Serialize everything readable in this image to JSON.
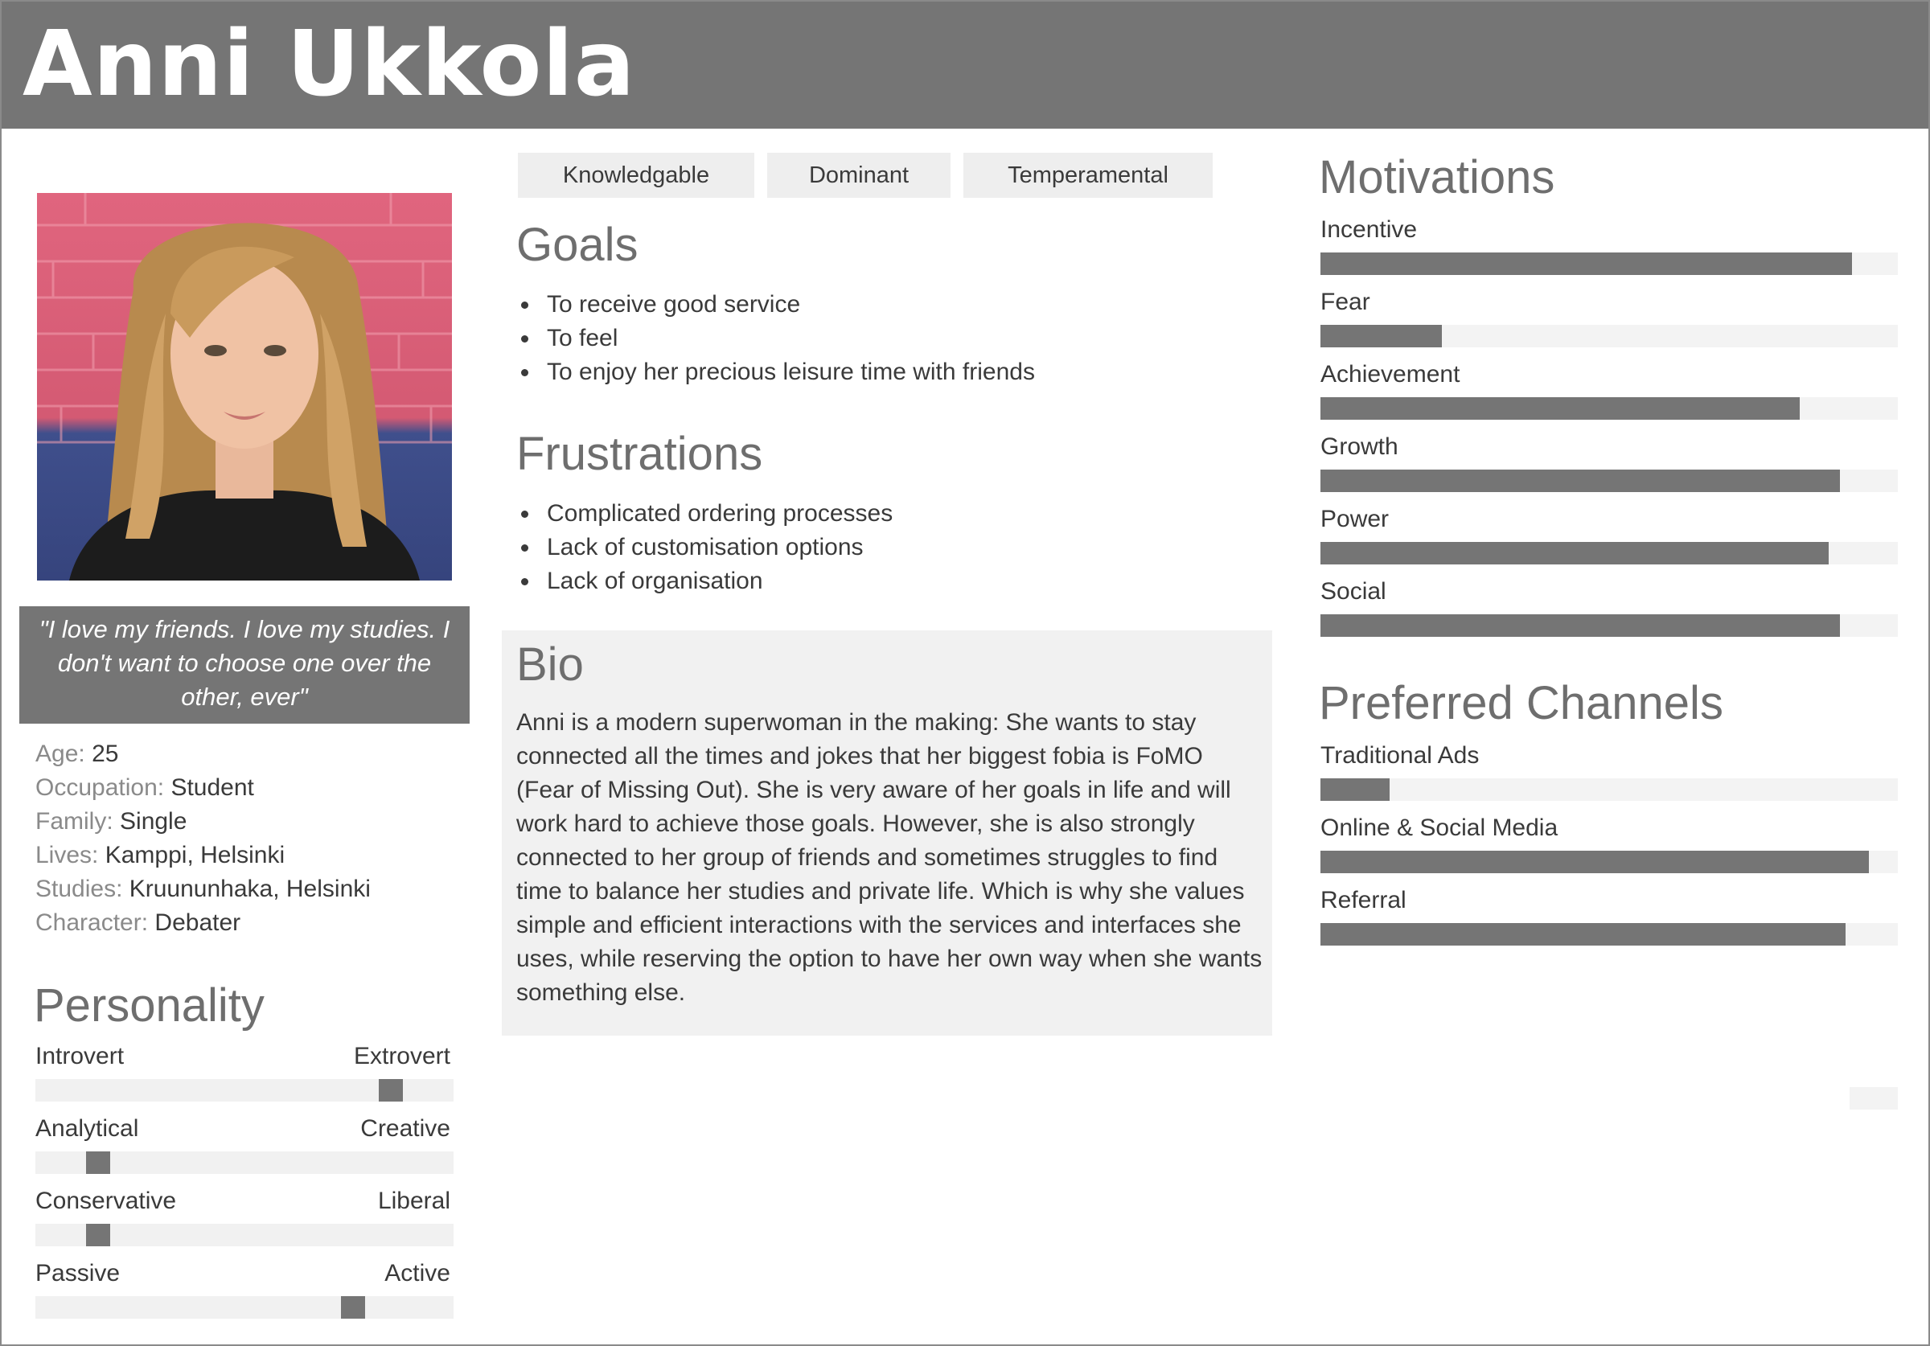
{
  "header": {
    "title": "Anni Ukkola"
  },
  "profile": {
    "photo_icon": "portrait-photo",
    "quote": "\"I love my friends. I love my studies. I don't want to choose one over the other, ever\"",
    "facts": [
      {
        "label": "Age:",
        "value": "25"
      },
      {
        "label": "Occupation:",
        "value": "Student"
      },
      {
        "label": "Family:",
        "value": "Single"
      },
      {
        "label": "Lives:",
        "value": "Kamppi, Helsinki"
      },
      {
        "label": "Studies:",
        "value": "Kruununhaka, Helsinki"
      },
      {
        "label": "Character:",
        "value": "Debater"
      }
    ]
  },
  "personality": {
    "title": "Personality",
    "traits": [
      {
        "left": "Introvert",
        "right": "Extrovert",
        "value": 0.85
      },
      {
        "left": "Analytical",
        "right": "Creative",
        "value": 0.15
      },
      {
        "left": "Conservative",
        "right": "Liberal",
        "value": 0.15
      },
      {
        "left": "Passive",
        "right": "Active",
        "value": 0.76
      }
    ]
  },
  "tags": [
    "Knowledgable",
    "Dominant",
    "Temperamental"
  ],
  "goals": {
    "title": "Goals",
    "items": [
      "To receive good service",
      "To feel",
      "To enjoy her precious leisure time with friends"
    ]
  },
  "frustrations": {
    "title": "Frustrations",
    "items": [
      "Complicated ordering processes",
      "Lack of customisation options",
      "Lack of organisation"
    ]
  },
  "bio": {
    "title": "Bio",
    "text": "Anni is a modern superwoman in the making: She wants to stay connected all the times and jokes that her biggest fobia is FoMO (Fear of Missing Out). She is very aware of her goals in life and will work hard to achieve those goals. However, she is also strongly connected to her group of friends and sometimes struggles to find time to balance her studies and private life. Which is why she values simple and efficient interactions with the services and interfaces she uses, while reserving the option to have her own way when she wants something else."
  },
  "motivations": {
    "title": "Motivations",
    "items": [
      {
        "label": "Incentive",
        "value": 0.92
      },
      {
        "label": "Fear",
        "value": 0.21
      },
      {
        "label": "Achievement",
        "value": 0.83
      },
      {
        "label": "Growth",
        "value": 0.9
      },
      {
        "label": "Power",
        "value": 0.88
      },
      {
        "label": "Social",
        "value": 0.9
      }
    ]
  },
  "channels": {
    "title": "Preferred Channels",
    "items": [
      {
        "label": "Traditional Ads",
        "value": 0.12
      },
      {
        "label": "Online & Social Media",
        "value": 0.95
      },
      {
        "label": "Referral",
        "value": 0.91
      }
    ]
  },
  "colors": {
    "header_bg": "#757575",
    "bar_fill": "#757575",
    "bar_track": "#f3f3f3",
    "panel_bg": "#f1f1f1"
  }
}
